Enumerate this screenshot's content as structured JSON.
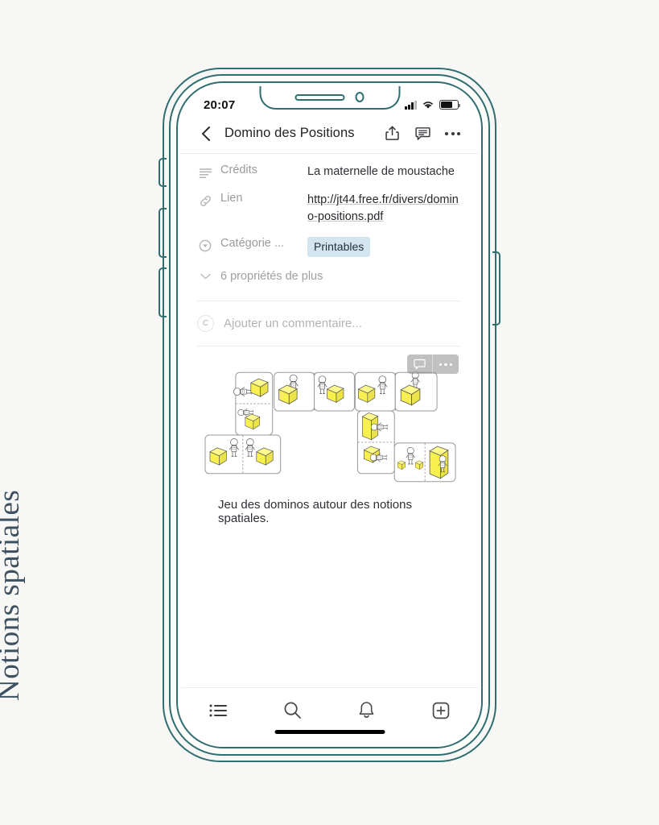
{
  "side_caption": "Notions spatiales",
  "status_bar": {
    "time": "20:07",
    "signal_icon": "cellular-signal-icon",
    "wifi_icon": "wifi-icon",
    "battery_icon": "battery-icon"
  },
  "header": {
    "back_icon": "back-chevron-icon",
    "title": "Domino des Positions",
    "share_icon": "share-icon",
    "comment_icon": "comment-icon",
    "more_icon": "more-options-icon"
  },
  "properties": [
    {
      "icon": "text-lines-icon",
      "label": "Crédits",
      "value": "La maternelle de moustache",
      "type": "text"
    },
    {
      "icon": "link-icon",
      "label": "Lien",
      "value": "http://jt44.free.fr/divers/domino-positions.pdf",
      "type": "link"
    },
    {
      "icon": "select-icon",
      "label": "Catégorie ...",
      "value": "Printables",
      "type": "tag"
    }
  ],
  "more_properties": {
    "icon": "chevron-down-icon",
    "label": "6 propriétés de plus"
  },
  "comment": {
    "avatar_initial": "C",
    "placeholder": "Ajouter un commentaire..."
  },
  "image_block": {
    "overlay_comment_icon": "comment-bubble-icon",
    "overlay_more_icon": "more-options-icon",
    "alt": "Planche de dominos illustrés avec personnages et cubes jaunes",
    "caption": "Jeu des dominos autour des notions spatiales."
  },
  "tabbar": [
    {
      "icon": "list-icon",
      "name": "tab-home"
    },
    {
      "icon": "search-icon",
      "name": "tab-search"
    },
    {
      "icon": "bell-icon",
      "name": "tab-notifications"
    },
    {
      "icon": "plus-box-icon",
      "name": "tab-new"
    }
  ],
  "colors": {
    "frame": "#2f6e70",
    "background": "#f7f7f5",
    "caption_text": "#3d5160",
    "tag_bg": "#d3e5ef",
    "cube_yellow": "#f6ed4f"
  }
}
